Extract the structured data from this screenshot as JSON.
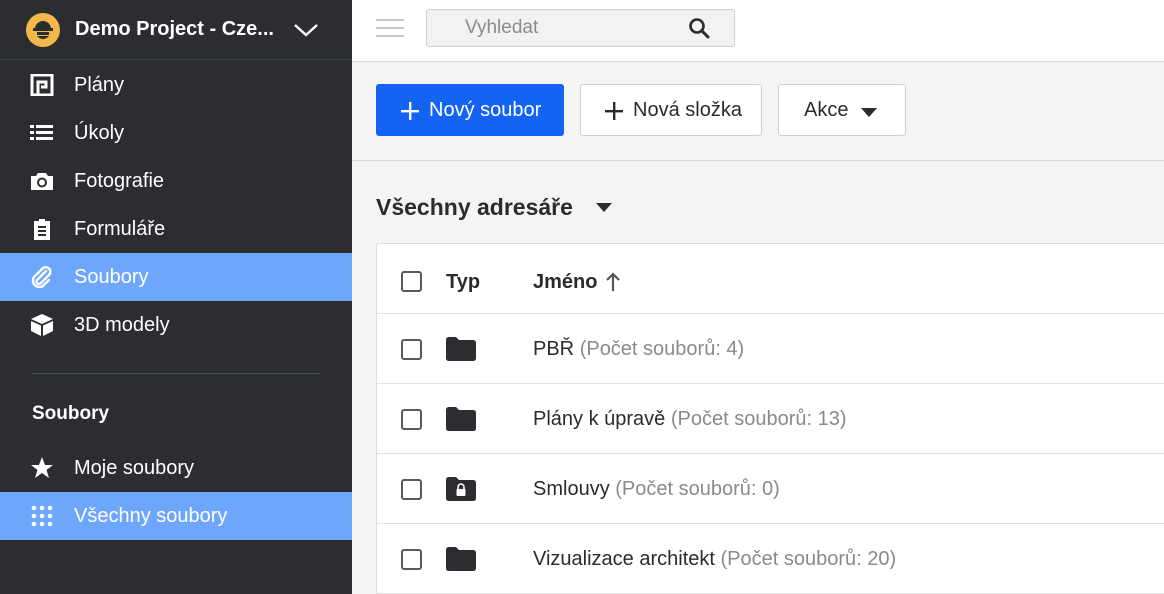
{
  "project": {
    "name": "Demo Project - Cze..."
  },
  "nav": {
    "items": [
      {
        "label": "Plány",
        "icon": "plans-icon"
      },
      {
        "label": "Úkoly",
        "icon": "list-icon"
      },
      {
        "label": "Fotografie",
        "icon": "camera-icon"
      },
      {
        "label": "Formuláře",
        "icon": "clipboard-icon"
      },
      {
        "label": "Soubory",
        "icon": "paperclip-icon",
        "active": true
      },
      {
        "label": "3D modely",
        "icon": "cube-icon"
      }
    ],
    "section_title": "Soubory",
    "sub_items": [
      {
        "label": "Moje soubory",
        "icon": "star-icon"
      },
      {
        "label": "Všechny soubory",
        "icon": "grid-icon",
        "active": true
      }
    ]
  },
  "search": {
    "placeholder": "Vyhledat"
  },
  "toolbar": {
    "new_file_label": "Nový soubor",
    "new_folder_label": "Nová složka",
    "actions_label": "Akce"
  },
  "heading": "Všechny adresáře",
  "table": {
    "col_type": "Typ",
    "col_name": "Jméno",
    "rows": [
      {
        "name": "PBŘ",
        "count": "(Počet souborů: 4)",
        "locked": false
      },
      {
        "name": "Plány k úpravě",
        "count": "(Počet souborů: 13)",
        "locked": false
      },
      {
        "name": "Smlouvy",
        "count": "(Počet souborů: 0)",
        "locked": true
      },
      {
        "name": "Vizualizace architekt",
        "count": "(Počet souborů: 20)",
        "locked": false
      }
    ]
  },
  "colors": {
    "sidebar": "#2b2d30",
    "active": "#6ea6fb",
    "primary": "#1463f3",
    "logo": "#f2b84b"
  }
}
